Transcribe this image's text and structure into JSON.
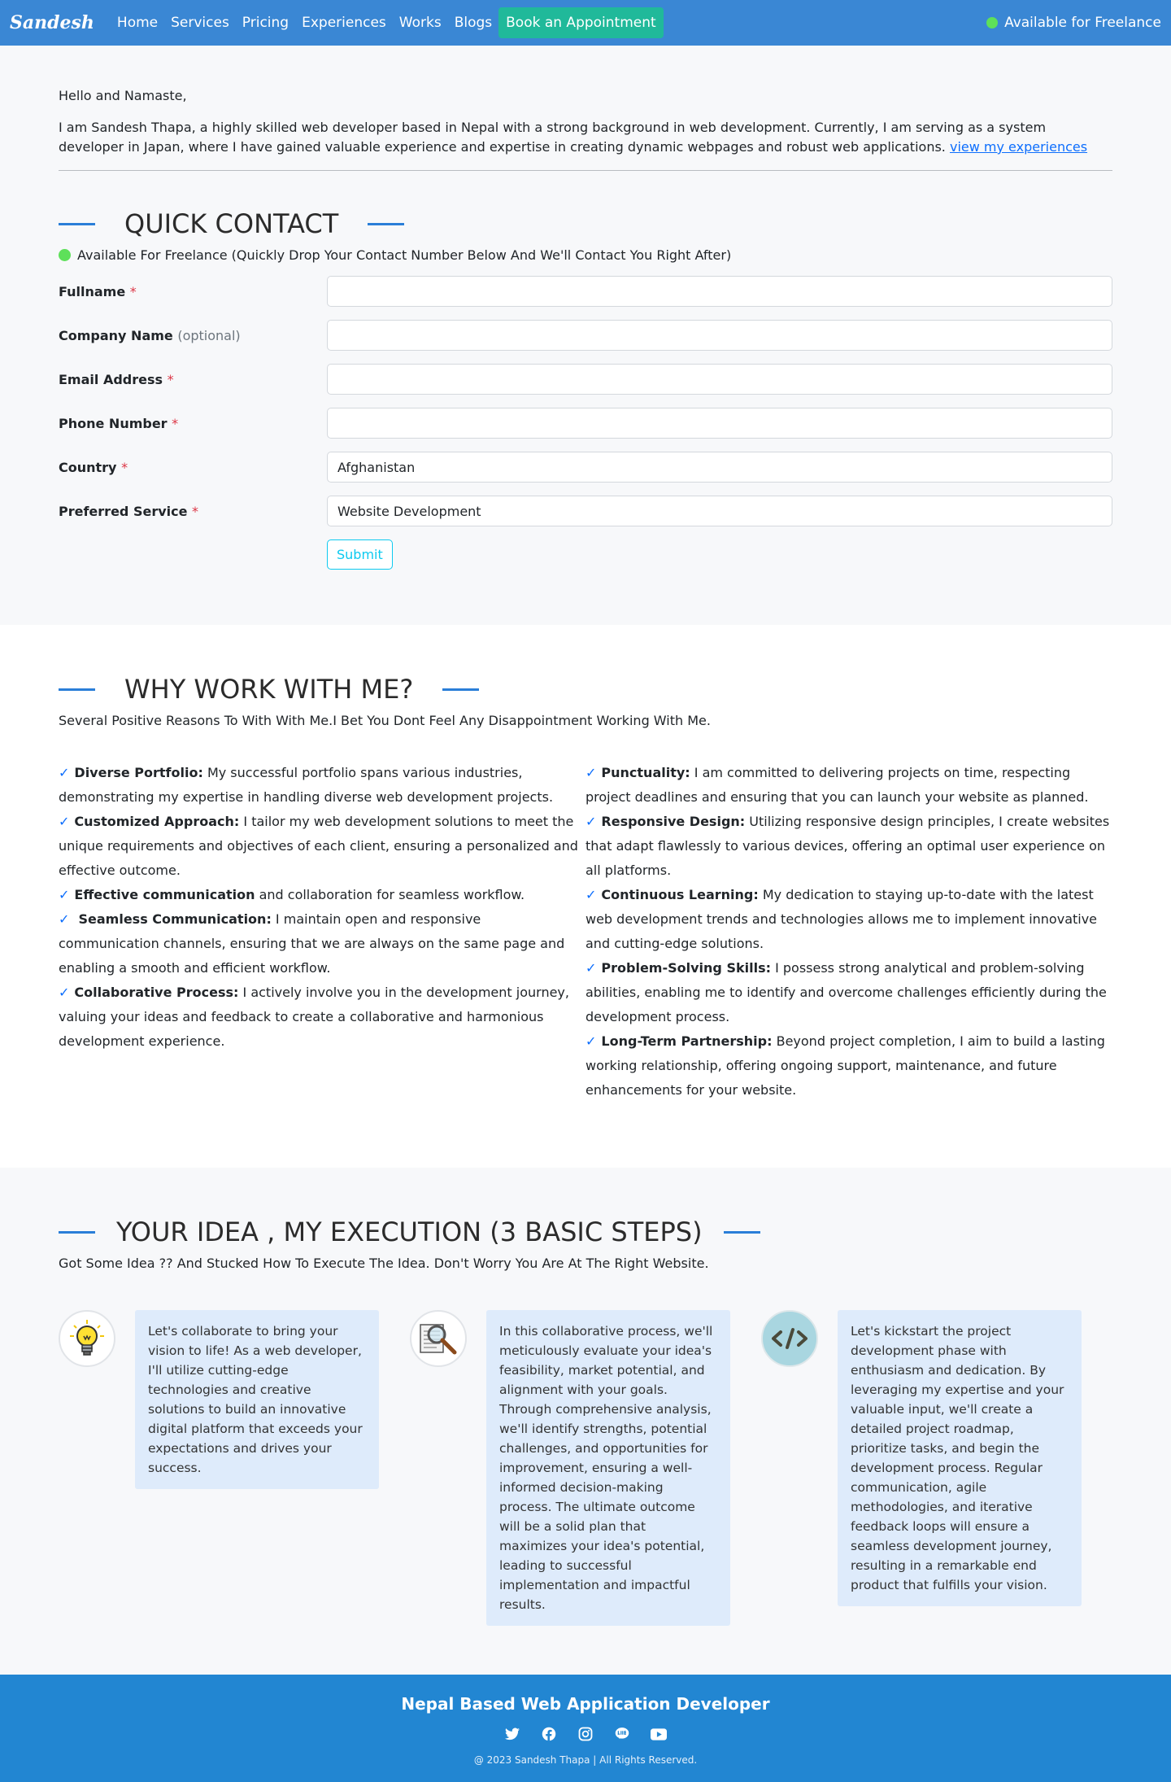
{
  "nav": {
    "brand": "Sandesh",
    "links": [
      "Home",
      "Services",
      "Pricing",
      "Experiences",
      "Works",
      "Blogs"
    ],
    "cta": "Book an Appointment",
    "status": "Available for Freelance"
  },
  "intro": {
    "greeting": "Hello and Namaste,",
    "text": "I am Sandesh Thapa, a highly skilled web developer based in Nepal with a strong background in web development. Currently, I am serving as a system developer in Japan, where I have gained valuable experience and expertise in creating dynamic webpages and robust web applications.",
    "link": "view my experiences"
  },
  "contact": {
    "title": "QUICK CONTACT",
    "availability": "Available For Freelance (Quickly Drop Your Contact Number Below And We'll Contact You Right After)",
    "fields": [
      {
        "label": "Fullname",
        "required": "*",
        "optional": "",
        "value": ""
      },
      {
        "label": "Company Name",
        "required": "",
        "optional": "(optional)",
        "value": ""
      },
      {
        "label": "Email Address",
        "required": "*",
        "optional": "",
        "value": ""
      },
      {
        "label": "Phone Number",
        "required": "*",
        "optional": "",
        "value": ""
      },
      {
        "label": "Country",
        "required": "*",
        "optional": "",
        "value": "Afghanistan"
      },
      {
        "label": "Preferred Service",
        "required": "*",
        "optional": "",
        "value": "Website Development"
      }
    ],
    "submit": "Submit"
  },
  "why": {
    "title": "WHY WORK WITH ME?",
    "subtitle": "Several Positive Reasons To With With Me.I Bet You Dont Feel Any Disappointment Working With Me.",
    "check": "✓",
    "left": [
      {
        "bold": "Diverse Portfolio:",
        "text": " My successful portfolio spans various industries, demonstrating my expertise in handling diverse web development projects."
      },
      {
        "bold": "Customized Approach:",
        "text": " I tailor my web development solutions to meet the unique requirements and objectives of each client, ensuring a personalized and effective outcome."
      },
      {
        "bold": "Effective communication",
        "text": " and collaboration for seamless workflow."
      },
      {
        "bold": "Seamless Communication:",
        "text": " I maintain open and responsive communication channels, ensuring that we are always on the same page and enabling a smooth and efficient workflow."
      },
      {
        "bold": "Collaborative Process:",
        "text": " I actively involve you in the development journey, valuing your ideas and feedback to create a collaborative and harmonious development experience."
      }
    ],
    "right": [
      {
        "bold": "Punctuality:",
        "text": " I am committed to delivering projects on time, respecting project deadlines and ensuring that you can launch your website as planned."
      },
      {
        "bold": "Responsive Design:",
        "text": " Utilizing responsive design principles, I create websites that adapt flawlessly to various devices, offering an optimal user experience on all platforms."
      },
      {
        "bold": "Continuous Learning:",
        "text": " My dedication to staying up-to-date with the latest web development trends and technologies allows me to implement innovative and cutting-edge solutions."
      },
      {
        "bold": "Problem-Solving Skills:",
        "text": " I possess strong analytical and problem-solving abilities, enabling me to identify and overcome challenges efficiently during the development process."
      },
      {
        "bold": "Long-Term Partnership:",
        "text": " Beyond project completion, I aim to build a lasting working relationship, offering ongoing support, maintenance, and future enhancements for your website."
      }
    ]
  },
  "steps": {
    "title": "YOUR IDEA , MY EXECUTION (3 BASIC STEPS)",
    "subtitle": "Got Some Idea ?? And Stucked How To Execute The Idea. Don't Worry You Are At The Right Website.",
    "items": [
      {
        "icon": "lightbulb-icon",
        "text": "Let's collaborate to bring your vision to life! As a web developer, I'll utilize cutting-edge technologies and creative solutions to build an innovative digital platform that exceeds your expectations and drives your success."
      },
      {
        "icon": "magnifier-document-icon",
        "text": "In this collaborative process, we'll meticulously evaluate your idea's feasibility, market potential, and alignment with your goals. Through comprehensive analysis, we'll identify strengths, potential challenges, and opportunities for improvement, ensuring a well-informed decision-making process. The ultimate outcome will be a solid plan that maximizes your idea's potential, leading to successful implementation and impactful results."
      },
      {
        "icon": "code-icon",
        "text": "Let's kickstart the project development phase with enthusiasm and dedication. By leveraging my expertise and your valuable input, we'll create a detailed project roadmap, prioritize tasks, and begin the development process. Regular communication, agile methodologies, and iterative feedback loops will ensure a seamless development journey, resulting in a remarkable end product that fulfills your vision."
      }
    ]
  },
  "footer": {
    "title": "Nepal Based Web Application Developer",
    "socials": [
      "twitter-icon",
      "facebook-icon",
      "instagram-icon",
      "line-icon",
      "youtube-icon"
    ],
    "copyright": "@ 2023 Sandesh Thapa | All Rights Reserved."
  }
}
